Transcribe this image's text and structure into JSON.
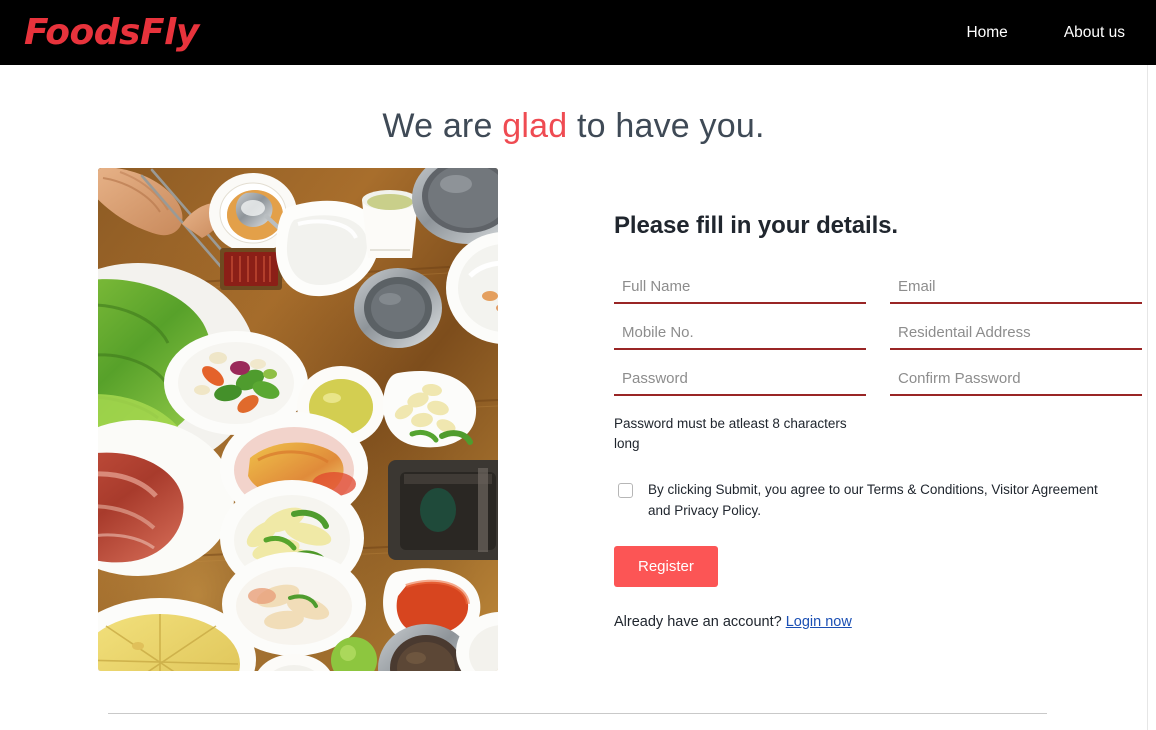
{
  "navbar": {
    "brand": "FoodsFly",
    "links": [
      {
        "label": "Home",
        "name": "nav-link-home"
      },
      {
        "label": "About us",
        "name": "nav-link-about-us"
      }
    ]
  },
  "hero": {
    "part1": "We are ",
    "accent": "glad",
    "part2": " to have you."
  },
  "form": {
    "title": "Please fill in your details.",
    "fields": [
      {
        "name": "full-name-input",
        "placeholder": "Full Name",
        "value": ""
      },
      {
        "name": "email-input",
        "placeholder": "Email",
        "value": ""
      },
      {
        "name": "mobile-no-input",
        "placeholder": "Mobile No.",
        "value": ""
      },
      {
        "name": "residential-address-input",
        "placeholder": "Residentail Address",
        "value": ""
      },
      {
        "name": "password-input",
        "placeholder": "Password",
        "value": ""
      },
      {
        "name": "confirm-password-input",
        "placeholder": "Confirm Password",
        "value": ""
      }
    ],
    "password_hint": "Password must be atleast 8 characters long",
    "terms_text": "By clicking Submit, you agree to our Terms & Conditions, Visitor Agreement and Privacy Policy.",
    "terms_checked": false,
    "register_label": "Register",
    "login_prompt": "Already have an account? ",
    "login_link": "Login now"
  },
  "media": {
    "photo_alt": "korean-food-spread-photo"
  },
  "colors": {
    "brand_red": "#e8333c",
    "accent_red": "#ef4b52",
    "button_red": "#fc5555",
    "input_underline": "#992525",
    "link_blue": "#1a4fb4",
    "navbar_bg": "#000000",
    "heading_gray": "#3f4a56",
    "divider": "#c9c9c9"
  }
}
